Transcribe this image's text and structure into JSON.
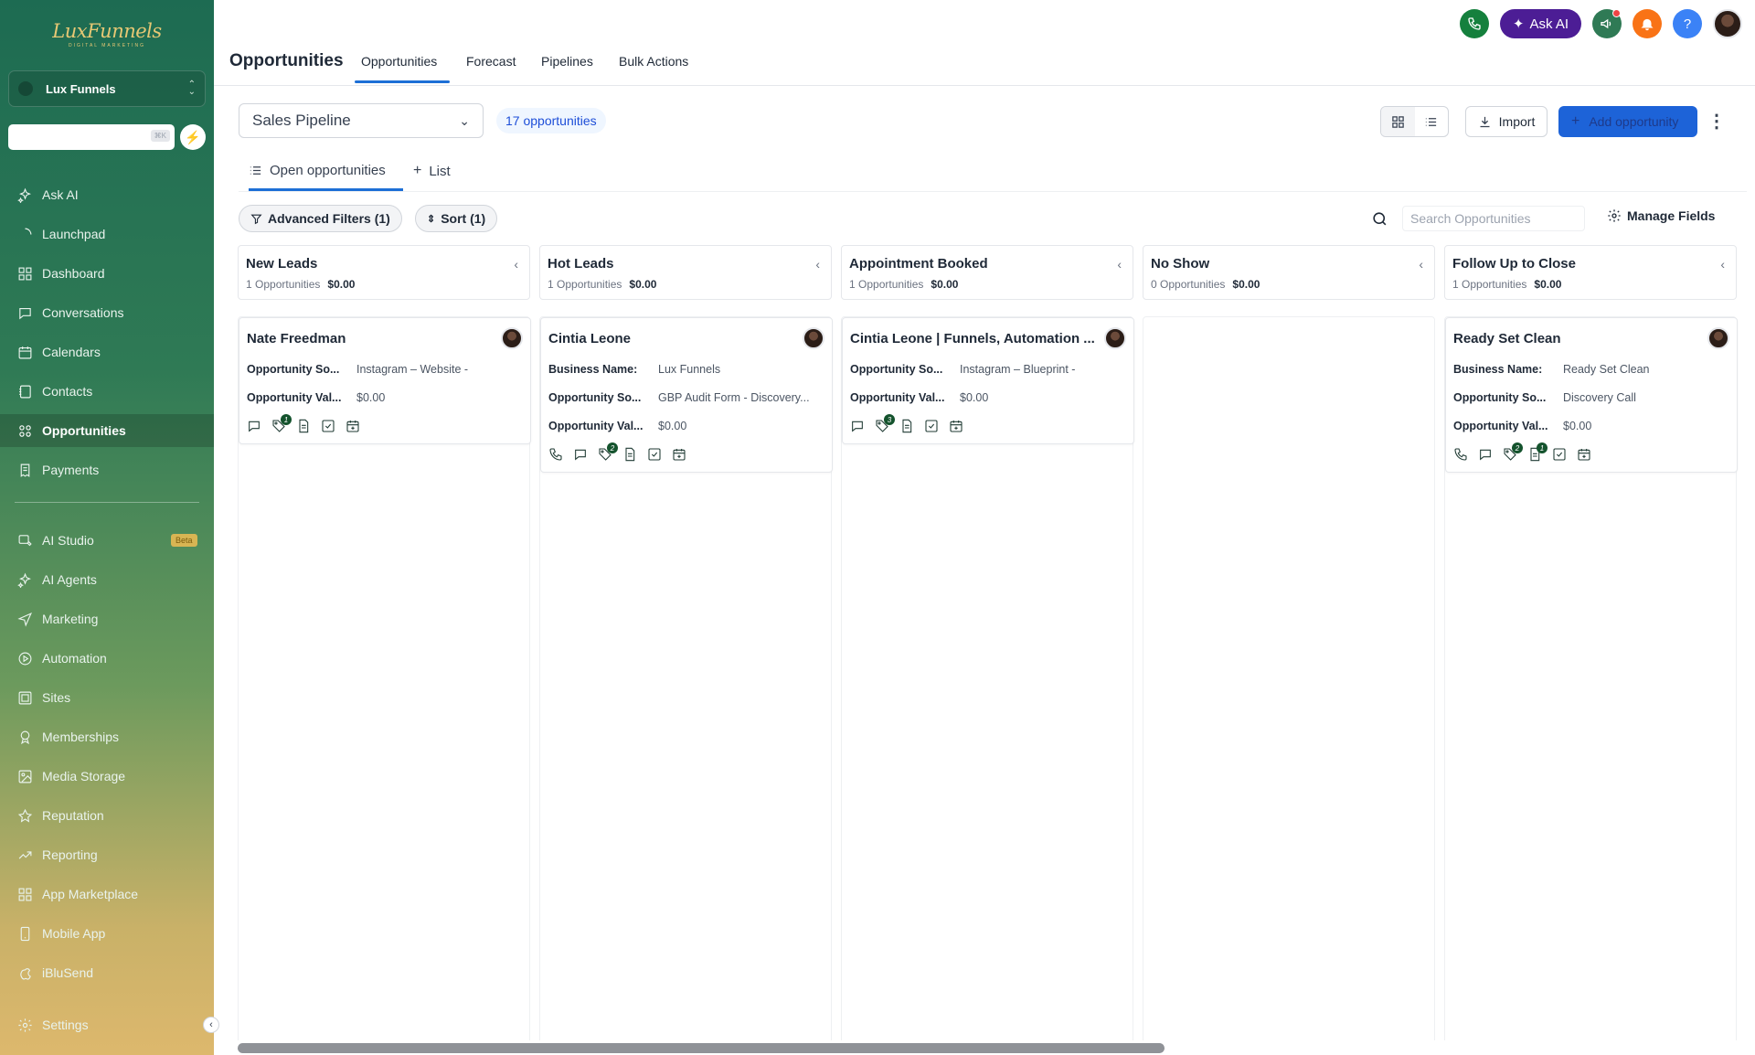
{
  "sidebar": {
    "brand": "LuxFunnels",
    "brand_tagline": "DIGITAL MARKETING",
    "account_name": "Lux Funnels",
    "search_shortcut": "⌘K",
    "items_top": [
      {
        "label": "Ask AI",
        "icon": "sparkle-icon"
      },
      {
        "label": "Launchpad",
        "icon": "launchpad-icon"
      },
      {
        "label": "Dashboard",
        "icon": "dashboard-icon"
      },
      {
        "label": "Conversations",
        "icon": "chat-icon"
      },
      {
        "label": "Calendars",
        "icon": "calendar-icon"
      },
      {
        "label": "Contacts",
        "icon": "contacts-icon"
      },
      {
        "label": "Opportunities",
        "icon": "opportunities-icon",
        "active": true
      },
      {
        "label": "Payments",
        "icon": "payments-icon"
      }
    ],
    "items_bottom": [
      {
        "label": "AI Studio",
        "icon": "ai-studio-icon",
        "badge": "Beta"
      },
      {
        "label": "AI Agents",
        "icon": "sparkle-icon"
      },
      {
        "label": "Marketing",
        "icon": "send-icon"
      },
      {
        "label": "Automation",
        "icon": "automation-icon"
      },
      {
        "label": "Sites",
        "icon": "sites-icon"
      },
      {
        "label": "Memberships",
        "icon": "award-icon"
      },
      {
        "label": "Media Storage",
        "icon": "image-icon"
      },
      {
        "label": "Reputation",
        "icon": "star-icon"
      },
      {
        "label": "Reporting",
        "icon": "trend-icon"
      },
      {
        "label": "App Marketplace",
        "icon": "grid-icon"
      },
      {
        "label": "Mobile App",
        "icon": "mobile-icon"
      },
      {
        "label": "iBluSend",
        "icon": "apple-icon"
      }
    ],
    "settings_label": "Settings"
  },
  "header": {
    "title": "Opportunities",
    "tabs": [
      "Opportunities",
      "Forecast",
      "Pipelines",
      "Bulk Actions"
    ],
    "active_tab": "Opportunities",
    "ask_ai_label": "Ask AI",
    "help_label": "?"
  },
  "toolbar": {
    "pipeline": "Sales Pipeline",
    "count_label": "17 opportunities",
    "import_label": "Import",
    "add_label": "Add opportunity",
    "subtabs": [
      "Open opportunities",
      "List"
    ],
    "filters_label": "Advanced Filters (1)",
    "sort_label": "Sort (1)",
    "search_placeholder": "Search Opportunities",
    "manage_fields_label": "Manage Fields"
  },
  "board": {
    "columns": [
      {
        "title": "New Leads",
        "count": "1 Opportunities",
        "value": "$0.00",
        "cards": [
          {
            "name": "Nate Freedman",
            "fields": [
              {
                "k": "Opportunity So...",
                "v": "Instagram – Website -"
              },
              {
                "k": "Opportunity Val...",
                "v": "$0.00"
              }
            ],
            "icons": [
              {
                "n": "chat-icon"
              },
              {
                "n": "tag-icon",
                "badge": "1"
              },
              {
                "n": "doc-icon"
              },
              {
                "n": "task-icon"
              },
              {
                "n": "appt-icon"
              }
            ]
          }
        ]
      },
      {
        "title": "Hot Leads",
        "count": "1 Opportunities",
        "value": "$0.00",
        "cards": [
          {
            "name": "Cintia Leone",
            "fields": [
              {
                "k": "Business Name:",
                "v": "Lux Funnels"
              },
              {
                "k": "Opportunity So...",
                "v": "GBP Audit Form - Discovery..."
              },
              {
                "k": "Opportunity Val...",
                "v": "$0.00"
              }
            ],
            "icons": [
              {
                "n": "phone-icon"
              },
              {
                "n": "chat-icon"
              },
              {
                "n": "tag-icon",
                "badge": "2"
              },
              {
                "n": "doc-icon"
              },
              {
                "n": "task-icon"
              },
              {
                "n": "appt-icon"
              }
            ]
          }
        ]
      },
      {
        "title": "Appointment Booked",
        "count": "1 Opportunities",
        "value": "$0.00",
        "cards": [
          {
            "name": "Cintia Leone | Funnels, Automation ...",
            "fields": [
              {
                "k": "Opportunity So...",
                "v": "Instagram – Blueprint -"
              },
              {
                "k": "Opportunity Val...",
                "v": "$0.00"
              }
            ],
            "icons": [
              {
                "n": "chat-icon"
              },
              {
                "n": "tag-icon",
                "badge": "3"
              },
              {
                "n": "doc-icon"
              },
              {
                "n": "task-icon"
              },
              {
                "n": "appt-icon"
              }
            ]
          }
        ]
      },
      {
        "title": "No Show",
        "count": "0 Opportunities",
        "value": "$0.00",
        "cards": []
      },
      {
        "title": "Follow Up to Close",
        "count": "1 Opportunities",
        "value": "$0.00",
        "cards": [
          {
            "name": "Ready Set Clean",
            "fields": [
              {
                "k": "Business Name:",
                "v": "Ready Set Clean"
              },
              {
                "k": "Opportunity So...",
                "v": "Discovery Call"
              },
              {
                "k": "Opportunity Val...",
                "v": "$0.00"
              }
            ],
            "icons": [
              {
                "n": "phone-icon"
              },
              {
                "n": "chat-icon"
              },
              {
                "n": "tag-icon",
                "badge": "2"
              },
              {
                "n": "doc-icon",
                "badge": "1"
              },
              {
                "n": "task-icon"
              },
              {
                "n": "appt-icon"
              }
            ]
          }
        ]
      }
    ]
  },
  "colors": {
    "primary": "#1d63d8",
    "sidebar_top": "#1d6b52",
    "sidebar_bottom": "#ddb86d",
    "phone_button": "#15803d",
    "ask_ai_button": "#4c1d95",
    "notification_button": "#f97316",
    "help_button": "#3b82f6"
  }
}
